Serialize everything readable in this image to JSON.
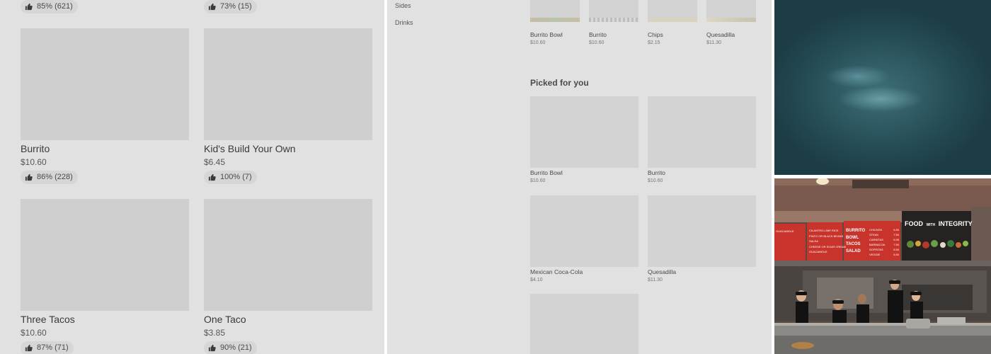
{
  "left_panel": {
    "top_ratings": [
      "85% (621)",
      "73% (15)"
    ],
    "items": [
      {
        "name": "Burrito",
        "price": "$10.60",
        "rating": "86% (228)"
      },
      {
        "name": "Kid's Build Your Own",
        "price": "$6.45",
        "rating": "100% (7)"
      },
      {
        "name": "Three Tacos",
        "price": "$10.60",
        "rating": "87% (71)"
      },
      {
        "name": "One Taco",
        "price": "$3.85",
        "rating": "90% (21)"
      }
    ]
  },
  "middle_panel": {
    "side_nav": [
      "Sides",
      "Drinks"
    ],
    "top_row": [
      {
        "name": "Burrito Bowl",
        "price": "$10.60"
      },
      {
        "name": "Burrito",
        "price": "$10.60"
      },
      {
        "name": "Chips",
        "price": "$2.15"
      },
      {
        "name": "Quesadilla",
        "price": "$11.30"
      }
    ],
    "section_title": "Picked for you",
    "picked": [
      {
        "name": "Burrito Bowl",
        "price": "$10.60"
      },
      {
        "name": "Burrito",
        "price": "$10.60"
      },
      {
        "name": "Mexican Coca-Cola",
        "price": "$4.10"
      },
      {
        "name": "Quesadilla",
        "price": "$11.30"
      }
    ]
  },
  "right_panel": {
    "menu_board": {
      "board1": [
        "GUACAMOLE"
      ],
      "board2": [
        "CILANTRO-LIME RICE",
        "PINTO OR BLACK BEANS",
        "SALSA",
        "CHEESE OR SOUR CREAM",
        "GUACAMOLE"
      ],
      "board3_items": [
        "BURRITO",
        "BOWL",
        "TACOS",
        "SALAD"
      ],
      "board3_proteins": [
        {
          "name": "CHICKEN",
          "price": "6.50"
        },
        {
          "name": "STEAK",
          "price": "7.50"
        },
        {
          "name": "CARNITAS",
          "price": "6.95"
        },
        {
          "name": "BARBACOA",
          "price": "7.50"
        },
        {
          "name": "SOFRITAS",
          "price": "6.50"
        },
        {
          "name": "VEGGIE",
          "price": "6.50"
        }
      ],
      "board4_title_a": "FOOD",
      "board4_title_b": "WITH",
      "board4_title_c": "INTEGRITY"
    }
  },
  "colors": {
    "thumb_icon": "#3a3a3a",
    "menu_board_red": "#c8342c",
    "menu_board_dark": "#262222"
  }
}
